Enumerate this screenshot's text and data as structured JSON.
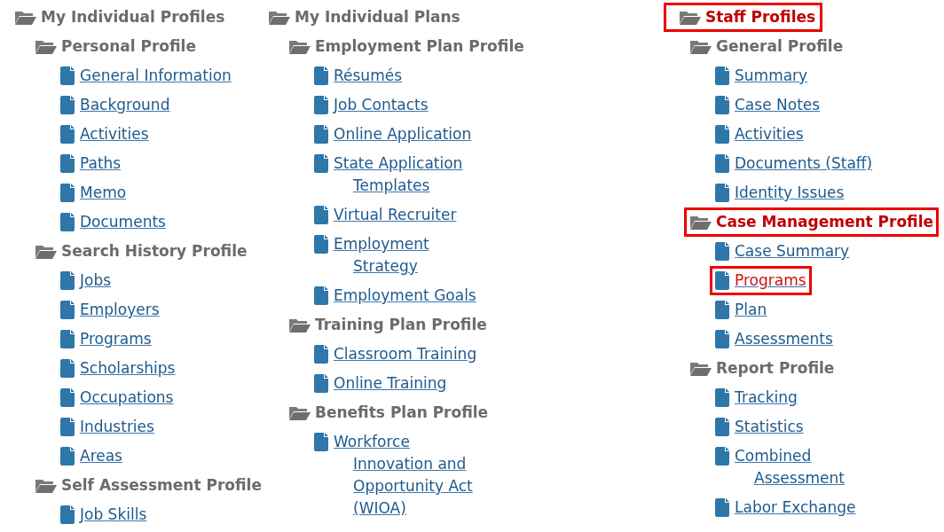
{
  "columns": [
    {
      "items": [
        {
          "kind": "folder",
          "label": "My Individual Profiles",
          "highlighted": false,
          "children": [
            {
              "kind": "folder",
              "label": "Personal Profile",
              "highlighted": false,
              "children": [
                {
                  "kind": "page",
                  "lines": [
                    "General Information"
                  ],
                  "highlighted": false
                },
                {
                  "kind": "page",
                  "lines": [
                    "Background"
                  ],
                  "highlighted": false
                },
                {
                  "kind": "page",
                  "lines": [
                    "Activities"
                  ],
                  "highlighted": false
                },
                {
                  "kind": "page",
                  "lines": [
                    "Paths"
                  ],
                  "highlighted": false
                },
                {
                  "kind": "page",
                  "lines": [
                    "Memo"
                  ],
                  "highlighted": false
                },
                {
                  "kind": "page",
                  "lines": [
                    "Documents"
                  ],
                  "highlighted": false
                }
              ]
            },
            {
              "kind": "folder",
              "label": "Search History Profile",
              "highlighted": false,
              "children": [
                {
                  "kind": "page",
                  "lines": [
                    "Jobs"
                  ],
                  "highlighted": false
                },
                {
                  "kind": "page",
                  "lines": [
                    "Employers"
                  ],
                  "highlighted": false
                },
                {
                  "kind": "page",
                  "lines": [
                    "Programs"
                  ],
                  "highlighted": false
                },
                {
                  "kind": "page",
                  "lines": [
                    "Scholarships"
                  ],
                  "highlighted": false
                },
                {
                  "kind": "page",
                  "lines": [
                    "Occupations"
                  ],
                  "highlighted": false
                },
                {
                  "kind": "page",
                  "lines": [
                    "Industries"
                  ],
                  "highlighted": false
                },
                {
                  "kind": "page",
                  "lines": [
                    "Areas"
                  ],
                  "highlighted": false
                }
              ]
            },
            {
              "kind": "folder",
              "label": "Self Assessment Profile",
              "highlighted": false,
              "children": [
                {
                  "kind": "page",
                  "lines": [
                    "Job Skills"
                  ],
                  "highlighted": false
                }
              ]
            }
          ]
        }
      ]
    },
    {
      "items": [
        {
          "kind": "folder",
          "label": "My Individual Plans",
          "highlighted": false,
          "children": [
            {
              "kind": "folder",
              "label": "Employment Plan Profile",
              "highlighted": false,
              "children": [
                {
                  "kind": "page",
                  "lines": [
                    "Résumés"
                  ],
                  "highlighted": false
                },
                {
                  "kind": "page",
                  "lines": [
                    "Job Contacts"
                  ],
                  "highlighted": false
                },
                {
                  "kind": "page",
                  "lines": [
                    "Online Application"
                  ],
                  "highlighted": false
                },
                {
                  "kind": "page",
                  "lines": [
                    "State Application",
                    "Templates"
                  ],
                  "highlighted": false
                },
                {
                  "kind": "page",
                  "lines": [
                    "Virtual Recruiter"
                  ],
                  "highlighted": false
                },
                {
                  "kind": "page",
                  "lines": [
                    "Employment",
                    "Strategy"
                  ],
                  "highlighted": false
                },
                {
                  "kind": "page",
                  "lines": [
                    "Employment Goals"
                  ],
                  "highlighted": false
                }
              ]
            },
            {
              "kind": "folder",
              "label": "Training Plan Profile",
              "highlighted": false,
              "children": [
                {
                  "kind": "page",
                  "lines": [
                    "Classroom Training"
                  ],
                  "highlighted": false
                },
                {
                  "kind": "page",
                  "lines": [
                    "Online Training"
                  ],
                  "highlighted": false
                }
              ]
            },
            {
              "kind": "folder",
              "label": "Benefits Plan Profile",
              "highlighted": false,
              "children": [
                {
                  "kind": "page",
                  "lines": [
                    "Workforce",
                    "Innovation and",
                    "Opportunity Act",
                    "(WIOA)"
                  ],
                  "highlighted": false
                }
              ]
            }
          ]
        }
      ]
    },
    {
      "items": [
        {
          "kind": "folder",
          "label": "Staff Profiles",
          "highlighted": true,
          "children": [
            {
              "kind": "folder",
              "label": "General Profile",
              "highlighted": false,
              "children": [
                {
                  "kind": "page",
                  "lines": [
                    "Summary"
                  ],
                  "highlighted": false
                },
                {
                  "kind": "page",
                  "lines": [
                    "Case Notes"
                  ],
                  "highlighted": false
                },
                {
                  "kind": "page",
                  "lines": [
                    "Activities"
                  ],
                  "highlighted": false
                },
                {
                  "kind": "page",
                  "lines": [
                    "Documents (Staff)"
                  ],
                  "highlighted": false
                },
                {
                  "kind": "page",
                  "lines": [
                    "Identity Issues"
                  ],
                  "highlighted": false
                }
              ]
            },
            {
              "kind": "folder",
              "label": "Case Management Profile",
              "highlighted": true,
              "children": [
                {
                  "kind": "page",
                  "lines": [
                    "Case Summary"
                  ],
                  "highlighted": false
                },
                {
                  "kind": "page",
                  "lines": [
                    "Programs"
                  ],
                  "highlighted": true
                },
                {
                  "kind": "page",
                  "lines": [
                    "Plan"
                  ],
                  "highlighted": false
                },
                {
                  "kind": "page",
                  "lines": [
                    "Assessments"
                  ],
                  "highlighted": false
                }
              ]
            },
            {
              "kind": "folder",
              "label": "Report Profile",
              "highlighted": false,
              "children": [
                {
                  "kind": "page",
                  "lines": [
                    "Tracking"
                  ],
                  "highlighted": false
                },
                {
                  "kind": "page",
                  "lines": [
                    "Statistics"
                  ],
                  "highlighted": false
                },
                {
                  "kind": "page",
                  "lines": [
                    "Combined",
                    "Assessment"
                  ],
                  "highlighted": false
                },
                {
                  "kind": "page",
                  "lines": [
                    "Labor Exchange"
                  ],
                  "highlighted": false
                }
              ]
            }
          ]
        }
      ]
    }
  ]
}
